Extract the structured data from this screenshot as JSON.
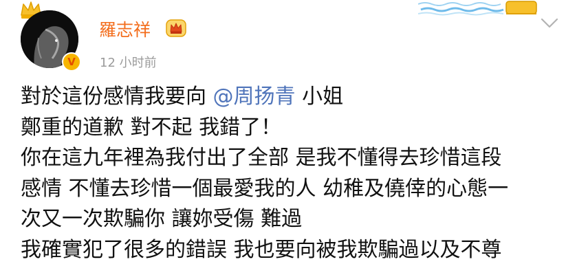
{
  "author": {
    "name": "羅志祥",
    "verified_badge": "V",
    "timestamp": "12 小时前",
    "avatar_icon": "lion-avatar",
    "member_icon": "crown-icon"
  },
  "post": {
    "line1_before": "對於這份感情我要向",
    "mention": "@周扬青",
    "line1_after": "小姐",
    "lines": [
      "鄭重的道歉 對不起 我錯了！",
      "你在這九年裡為我付出了全部 是我不懂得去珍惜這段",
      "感情 不懂去珍惜一個最愛我的人 幼稚及僥倖的心態一",
      "次又一次欺騙你 讓妳受傷 難過",
      "我確實犯了很多的錯誤 我也要向被我欺騙過以及不尊"
    ]
  },
  "colors": {
    "username": "#f36d1c",
    "mention": "#4f74ba",
    "timestamp": "#9b9b9b",
    "body_text": "#111111"
  }
}
